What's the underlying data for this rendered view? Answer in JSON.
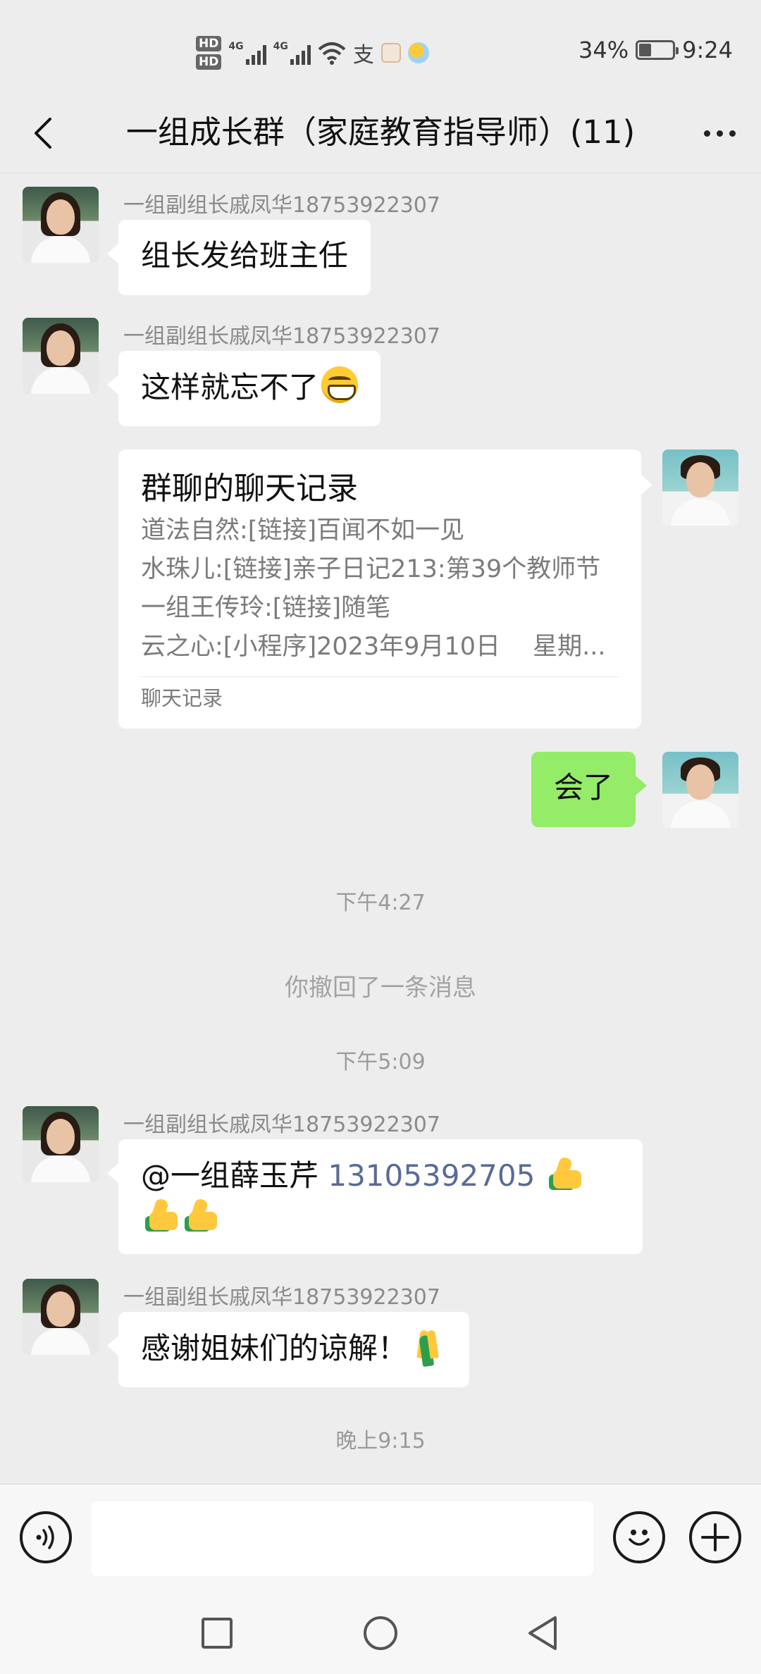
{
  "status_bar": {
    "hd1": "HD",
    "hd2": "HD",
    "net1": "4G",
    "net2": "4G",
    "pay_glyph": "支",
    "battery_percent": "34%",
    "battery_level": 0.34,
    "time": "9:24"
  },
  "nav": {
    "title": "一组成长群（家庭教育指导师）(11)"
  },
  "messages": [
    {
      "sender": "一组副组长戚凤华18753922307",
      "text": "组长发给班主任"
    },
    {
      "sender": "一组副组长戚凤华18753922307",
      "text": "这样就忘不了",
      "emoji": "grinning-face"
    },
    {
      "card": {
        "title": "群聊的聊天记录",
        "lines": [
          "道法自然:[链接]百闻不如一见",
          "水珠儿:[链接]亲子日记213:第39个教师节",
          "一组王传玲:[链接]随笔",
          "云之心:[小程序]2023年9月10日　 星期..."
        ],
        "footer": "聊天记录"
      }
    },
    {
      "text": "会了"
    },
    {
      "time": "下午4:27"
    },
    {
      "system": "你撤回了一条消息"
    },
    {
      "time": "下午5:09"
    },
    {
      "sender": "一组副组长戚凤华18753922307",
      "mention": "@一组薛玉芹 ",
      "phone": "13105392705",
      "emoji": "thumbs-up"
    },
    {
      "sender": "一组副组长戚凤华18753922307",
      "text": "感谢姐妹们的谅解！",
      "emoji": "folded-hands"
    },
    {
      "time": "晚上9:15"
    }
  ],
  "input": {
    "value": "",
    "placeholder": ""
  },
  "colors": {
    "background": "#ededed",
    "bubble_in": "#ffffff",
    "bubble_out": "#95ec69",
    "link": "#576b95"
  }
}
